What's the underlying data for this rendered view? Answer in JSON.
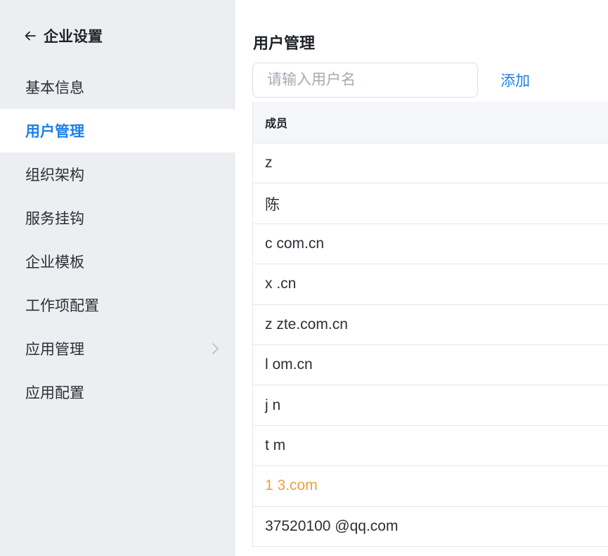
{
  "sidebar": {
    "back_icon": "arrow-left-icon",
    "title": "企业设置",
    "items": [
      {
        "label": "基本信息",
        "active": false
      },
      {
        "label": "用户管理",
        "active": true
      },
      {
        "label": "组织架构",
        "active": false
      },
      {
        "label": "服务挂钩",
        "active": false
      },
      {
        "label": "企业模板",
        "active": false
      },
      {
        "label": "工作项配置",
        "active": false
      },
      {
        "label": "应用管理",
        "active": false,
        "has_submenu": true,
        "chevron_icon": "chevron-right-icon"
      },
      {
        "label": "应用配置",
        "active": false
      }
    ]
  },
  "main": {
    "title": "用户管理",
    "search": {
      "placeholder": "请输入用户名",
      "value": ""
    },
    "add_label": "添加",
    "table": {
      "header": "成员",
      "rows": [
        "z",
        "陈",
        "c              com.cn",
        "x               .cn",
        "z              zte.com.cn",
        "l              om.cn",
        "j              n",
        "t              m",
        "1              3.com",
        "37520100 @qq.com"
      ]
    }
  },
  "colors": {
    "sidebar_bg": "#eceef1",
    "accent": "#1e7fe8",
    "header_bg": "#f4f6f9",
    "border": "#e6e8eb"
  }
}
